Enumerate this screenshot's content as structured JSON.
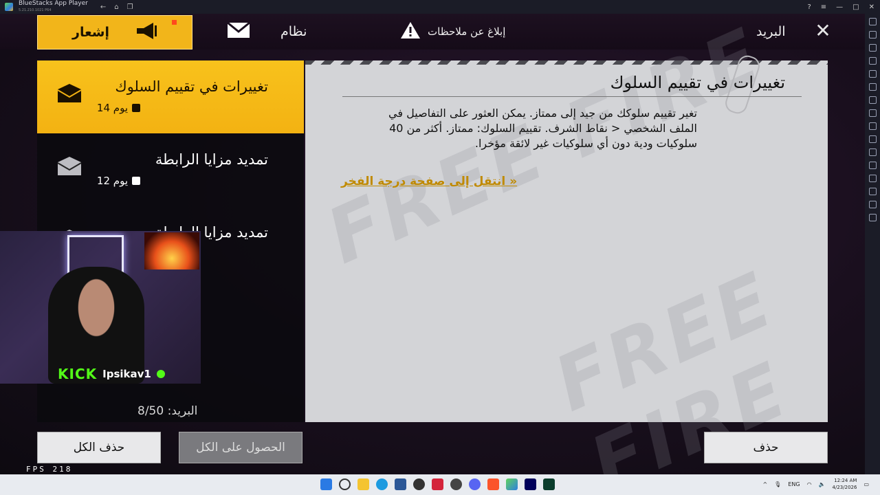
{
  "window": {
    "app_title": "BlueStacks App Player",
    "version": "5.21.210.1021 P64"
  },
  "tabs": {
    "notice_label": "إشعار",
    "system_label": "نظام",
    "report_label": "إبلاغ عن ملاحظات",
    "mail_label": "البريد"
  },
  "mail_list": {
    "items": [
      {
        "title": "تغييرات في تقييم السلوك",
        "age": "14 يوم",
        "selected": true
      },
      {
        "title": "تمديد مزايا الرابطة",
        "age": "12 يوم",
        "selected": false
      },
      {
        "title": "تمديد مزايا الرابطة",
        "age": "",
        "selected": false
      }
    ],
    "count_label": "البريد: 8/50"
  },
  "detail": {
    "title": "تغييرات في تقييم السلوك",
    "body": "تغير تقييم سلوكك من جيد إلى ممتاز. يمكن العثور على التفاصيل في الملف الشخصي < نقاط الشرف. تقييم السلوك: ممتاز. أكثر من 40 سلوكيات ودية دون أي سلوكيات غير لائقة مؤخرا.",
    "link": "انتقل إلى صفحة درجة الفخر »",
    "watermark": "FREE FIRE"
  },
  "buttons": {
    "delete_all": "حذف الكل",
    "claim_all": "الحصول على الكل",
    "delete": "حذف"
  },
  "webcam": {
    "platform": "KICK",
    "username": "Ipsikav1"
  },
  "fps": {
    "label": "FPS 218"
  },
  "taskbar": {
    "language": "ENG",
    "time": "12:24 AM",
    "date": "4/23/2026"
  },
  "colors": {
    "accent_yellow": "#f2b51a",
    "detail_bg": "#d3d4d7",
    "link_gold": "#c08a00",
    "kick_green": "#53fc18"
  }
}
